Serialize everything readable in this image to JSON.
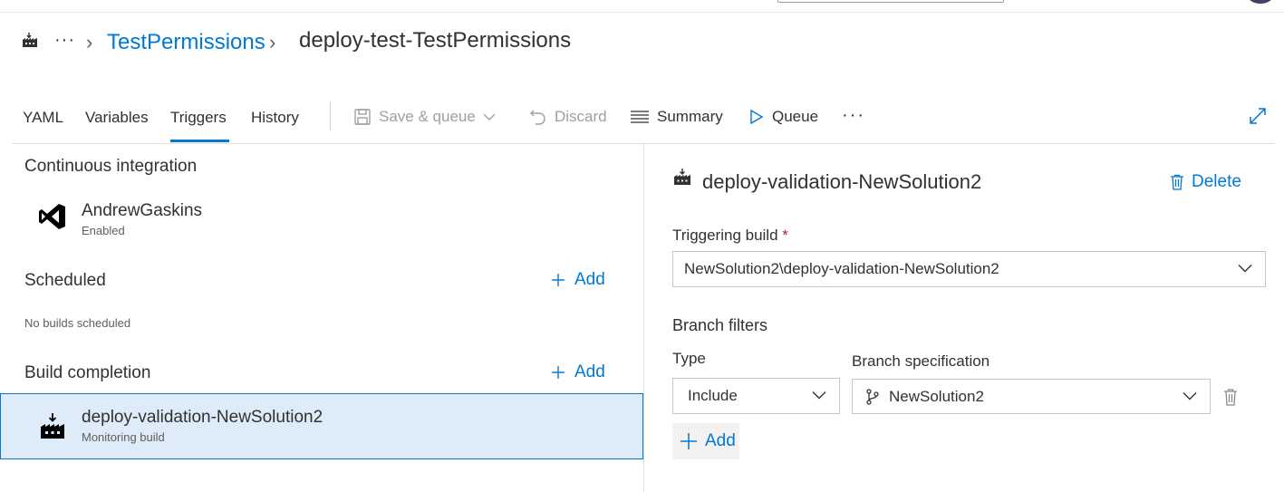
{
  "breadcrumb": {
    "more": "···",
    "project": "TestPermissions",
    "pipeline": "deploy-test-TestPermissions"
  },
  "tabs": [
    {
      "label": "YAML"
    },
    {
      "label": "Variables"
    },
    {
      "label": "Triggers",
      "active": true
    },
    {
      "label": "History"
    }
  ],
  "toolbar": {
    "save_queue": "Save & queue",
    "discard": "Discard",
    "summary": "Summary",
    "queue": "Queue",
    "more": "···"
  },
  "left": {
    "ci": {
      "title": "Continuous integration",
      "item_name": "AndrewGaskins",
      "item_status": "Enabled"
    },
    "scheduled": {
      "title": "Scheduled",
      "add": "Add",
      "empty": "No builds scheduled"
    },
    "build_completion": {
      "title": "Build completion",
      "add": "Add",
      "item_name": "deploy-validation-NewSolution2",
      "item_status": "Monitoring build"
    }
  },
  "right": {
    "title": "deploy-validation-NewSolution2",
    "delete": "Delete",
    "triggering_label": "Triggering build",
    "required_mark": "*",
    "triggering_value": "NewSolution2\\deploy-validation-NewSolution2",
    "branch_filters": "Branch filters",
    "type_label": "Type",
    "type_value": "Include",
    "branch_spec_label": "Branch specification",
    "branch_spec_value": "NewSolution2",
    "add": "Add"
  },
  "colors": {
    "accent": "#0078d4",
    "selected_bg": "#deecf9",
    "required": "#a4262c"
  }
}
